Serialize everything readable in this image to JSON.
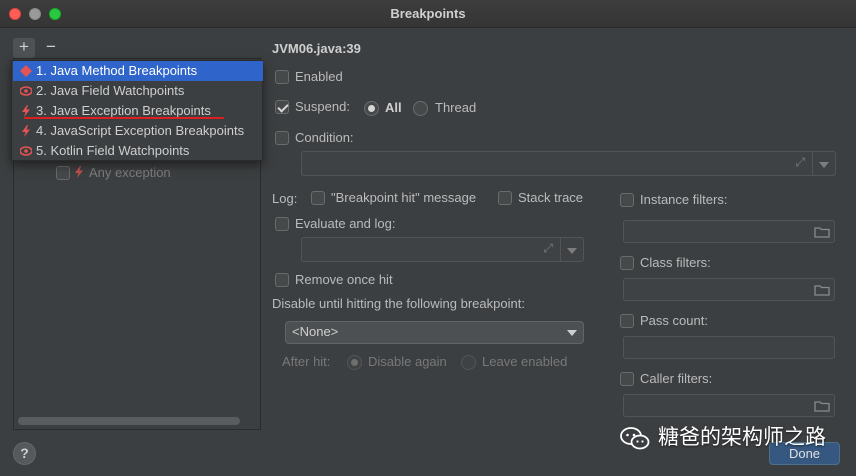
{
  "window": {
    "title": "Breakpoints"
  },
  "toolbar": {
    "add_label": "+",
    "remove_label": "−"
  },
  "popup": {
    "items": [
      {
        "label": "1. Java Method Breakpoints",
        "icon": "diamond-icon",
        "selected": true
      },
      {
        "label": "2. Java Field Watchpoints",
        "icon": "eye-icon",
        "selected": false
      },
      {
        "label": "3. Java Exception Breakpoints",
        "icon": "lightning-icon",
        "selected": false
      },
      {
        "label": "4. JavaScript Exception Breakpoints",
        "icon": "lightning-icon",
        "selected": false
      },
      {
        "label": "5. Kotlin Field Watchpoints",
        "icon": "eye-icon",
        "selected": false
      }
    ]
  },
  "tree": {
    "any_exception_label": "Any exception"
  },
  "details": {
    "location": "JVM06.java:39",
    "enabled_label": "Enabled",
    "enabled_checked": false,
    "suspend_label": "Suspend:",
    "suspend_checked": true,
    "suspend_all_label": "All",
    "suspend_thread_label": "Thread",
    "suspend_selected": "All",
    "condition_label": "Condition:",
    "condition_value": "",
    "log_label": "Log:",
    "log_message_label": "\"Breakpoint hit\" message",
    "stack_trace_label": "Stack trace",
    "evaluate_log_label": "Evaluate and log:",
    "evaluate_value": "",
    "remove_once_hit_label": "Remove once hit",
    "disable_until_label": "Disable until hitting the following breakpoint:",
    "disable_until_value": "<None>",
    "after_hit_label": "After hit:",
    "disable_again_label": "Disable again",
    "leave_enabled_label": "Leave enabled"
  },
  "filters": {
    "instance_label": "Instance filters:",
    "class_label": "Class filters:",
    "pass_count_label": "Pass count:",
    "caller_label": "Caller filters:"
  },
  "footer": {
    "help_label": "?",
    "done_label": "Done"
  },
  "watermark": {
    "text": "糖爸的架构师之路"
  },
  "colors": {
    "selection": "#2f65ca",
    "annotation_red": "#e01e1e",
    "done_button": "#365880"
  }
}
